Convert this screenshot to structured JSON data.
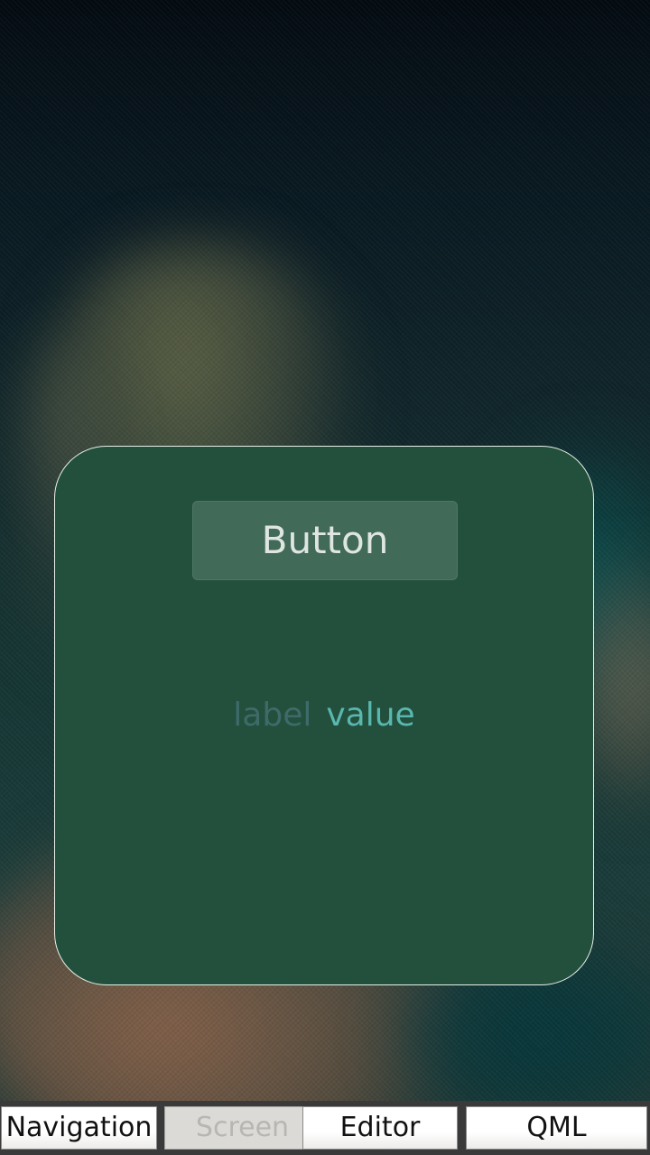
{
  "panel": {
    "button_label": "Button",
    "label": "label",
    "value": "value"
  },
  "tabs": [
    {
      "label": "Navigation",
      "active": false
    },
    {
      "label": "Screen",
      "active": true
    },
    {
      "label": "Editor",
      "active": false
    },
    {
      "label": "QML",
      "active": false
    }
  ],
  "colors": {
    "panel_background": "#22503c",
    "panel_border": "#e8efe9",
    "button_background": "#416a59",
    "label_color": "#3e6a6a",
    "value_color": "#5ab7b0",
    "tab_active_text": "#b8b6b3"
  }
}
